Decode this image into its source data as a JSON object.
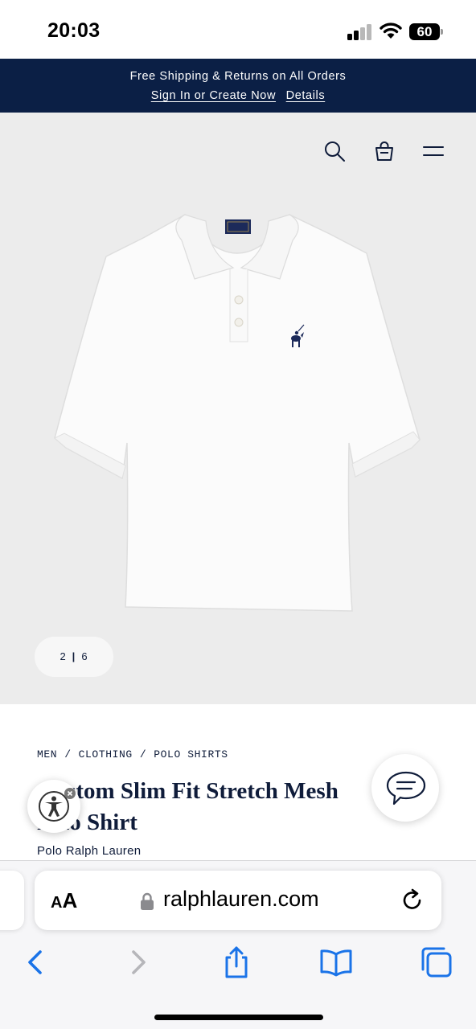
{
  "status_bar": {
    "time": "20:03",
    "battery": "60"
  },
  "promo": {
    "message": "Free Shipping & Returns on All Orders",
    "signin_link": "Sign In or Create Now",
    "details_link": "Details"
  },
  "header": {
    "icons": [
      "search-icon",
      "shopping-bag-icon",
      "menu-icon"
    ]
  },
  "gallery": {
    "current": "2",
    "separator": "|",
    "total": "6"
  },
  "product": {
    "breadcrumb": [
      "MEN",
      "CLOTHING",
      "POLO SHIRTS"
    ],
    "breadcrumb_sep": "/",
    "title_line1": "Custom Slim Fit Stretch Mesh",
    "title_line2": "Polo Shirt",
    "brand": "Polo Ralph Lauren",
    "logo_label": "POLO RALPH LAUREN"
  },
  "safari": {
    "text_size_label_small": "A",
    "text_size_label_large": "A",
    "url": "ralphlauren.com",
    "accent_color": "#1a73e8"
  },
  "colors": {
    "banner_bg": "#0b1f45",
    "hero_bg": "#ececec",
    "text_navy": "#0f1c3a"
  }
}
